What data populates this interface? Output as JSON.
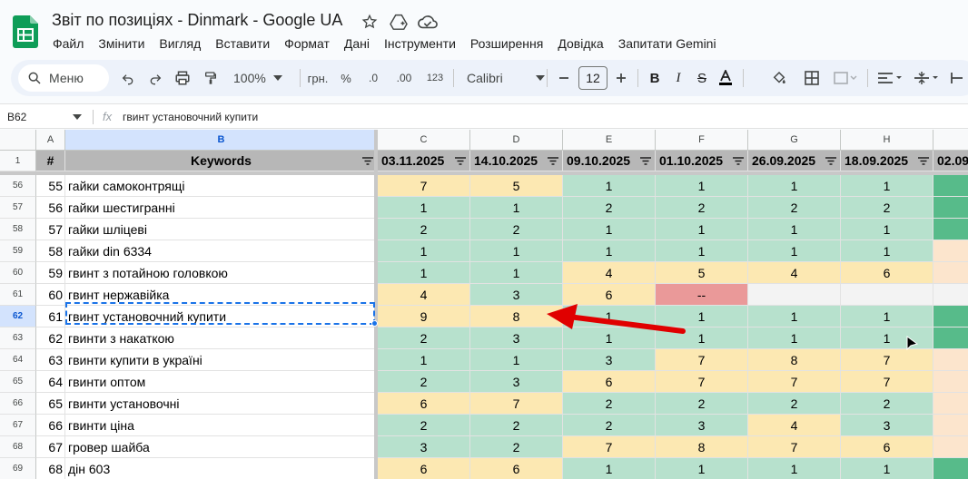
{
  "app": {
    "title": "Звіт по позиціях - Dinmark - Google UA",
    "menu": [
      "Файл",
      "Змінити",
      "Вигляд",
      "Вставити",
      "Формат",
      "Дані",
      "Інструменти",
      "Розширення",
      "Довідка",
      "Запитати Gemini"
    ]
  },
  "toolbar": {
    "search_label": "Меню",
    "zoom": "100%",
    "currency": "грн.",
    "percent": "%",
    "decimal_decrease": ".0",
    "decimal_increase": ".00",
    "number_format": "123",
    "font": "Calibri",
    "font_size": "12"
  },
  "formula_bar": {
    "cell_ref": "B62",
    "fx": "fx",
    "formula": "гвинт установочний купити"
  },
  "colors": {
    "green": "#b7e1cd",
    "yellow": "#fce8b2",
    "red": "#ea9999",
    "peach": "#fce5cd",
    "dark_green": "#57bb8a",
    "header_gray": "#b7b7b7",
    "arrow_red": "#e00000"
  },
  "sheet": {
    "columns": [
      "A",
      "B",
      "C",
      "D",
      "E",
      "F",
      "G",
      "H"
    ],
    "header_row_number": "1",
    "headers": [
      "#",
      "Keywords",
      "03.11.2025",
      "14.10.2025",
      "09.10.2025",
      "01.10.2025",
      "26.09.2025",
      "18.09.2025",
      "02.09"
    ],
    "rows": [
      {
        "row": "56",
        "num": "55",
        "keyword": "гайки самоконтрящі",
        "values": [
          "7",
          "5",
          "1",
          "1",
          "1",
          "1"
        ],
        "colors": [
          "yellow",
          "yellow",
          "green",
          "green",
          "green",
          "green",
          "dark_green"
        ]
      },
      {
        "row": "57",
        "num": "56",
        "keyword": "гайки шестигранні",
        "values": [
          "1",
          "1",
          "2",
          "2",
          "2",
          "2"
        ],
        "colors": [
          "green",
          "green",
          "green",
          "green",
          "green",
          "green",
          "dark_green"
        ]
      },
      {
        "row": "58",
        "num": "57",
        "keyword": "гайки шліцеві",
        "values": [
          "2",
          "2",
          "1",
          "1",
          "1",
          "1"
        ],
        "colors": [
          "green",
          "green",
          "green",
          "green",
          "green",
          "green",
          "dark_green"
        ]
      },
      {
        "row": "59",
        "num": "58",
        "keyword": "гайки din 6334",
        "values": [
          "1",
          "1",
          "1",
          "1",
          "1",
          "1"
        ],
        "colors": [
          "green",
          "green",
          "green",
          "green",
          "green",
          "green",
          "peach"
        ]
      },
      {
        "row": "60",
        "num": "59",
        "keyword": "гвинт з потайною головкою",
        "values": [
          "1",
          "1",
          "4",
          "5",
          "4",
          "6"
        ],
        "colors": [
          "green",
          "green",
          "yellow",
          "yellow",
          "yellow",
          "yellow",
          "peach"
        ]
      },
      {
        "row": "61",
        "num": "60",
        "keyword": "гвинт нержавійка",
        "values": [
          "4",
          "3",
          "6",
          "--",
          "",
          ""
        ],
        "colors": [
          "yellow",
          "green",
          "yellow",
          "red",
          "blank",
          "blank",
          "blank"
        ]
      },
      {
        "row": "62",
        "num": "61",
        "keyword": "гвинт установочний купити",
        "values": [
          "9",
          "8",
          "1",
          "1",
          "1",
          "1"
        ],
        "colors": [
          "yellow",
          "yellow",
          "green",
          "green",
          "green",
          "green",
          "dark_green"
        ]
      },
      {
        "row": "63",
        "num": "62",
        "keyword": "гвинти з накаткою",
        "values": [
          "2",
          "3",
          "1",
          "1",
          "1",
          "1"
        ],
        "colors": [
          "green",
          "green",
          "green",
          "green",
          "green",
          "green",
          "dark_green"
        ]
      },
      {
        "row": "64",
        "num": "63",
        "keyword": "гвинти купити в україні",
        "values": [
          "1",
          "1",
          "3",
          "7",
          "8",
          "7"
        ],
        "colors": [
          "green",
          "green",
          "green",
          "yellow",
          "yellow",
          "yellow",
          "peach"
        ]
      },
      {
        "row": "65",
        "num": "64",
        "keyword": "гвинти оптом",
        "values": [
          "2",
          "3",
          "6",
          "7",
          "7",
          "7"
        ],
        "colors": [
          "green",
          "green",
          "yellow",
          "yellow",
          "yellow",
          "yellow",
          "peach"
        ]
      },
      {
        "row": "66",
        "num": "65",
        "keyword": "гвинти установочні",
        "values": [
          "6",
          "7",
          "2",
          "2",
          "2",
          "2"
        ],
        "colors": [
          "yellow",
          "yellow",
          "green",
          "green",
          "green",
          "green",
          "peach"
        ]
      },
      {
        "row": "67",
        "num": "66",
        "keyword": "гвинти ціна",
        "values": [
          "2",
          "2",
          "2",
          "3",
          "4",
          "3"
        ],
        "colors": [
          "green",
          "green",
          "green",
          "green",
          "yellow",
          "green",
          "peach"
        ]
      },
      {
        "row": "68",
        "num": "67",
        "keyword": "гровер шайба",
        "values": [
          "3",
          "2",
          "7",
          "8",
          "7",
          "6"
        ],
        "colors": [
          "green",
          "green",
          "yellow",
          "yellow",
          "yellow",
          "yellow",
          "peach"
        ]
      },
      {
        "row": "69",
        "num": "68",
        "keyword": "дін 603",
        "values": [
          "6",
          "6",
          "1",
          "1",
          "1",
          "1"
        ],
        "colors": [
          "yellow",
          "yellow",
          "green",
          "green",
          "green",
          "green",
          "dark_green"
        ]
      }
    ]
  }
}
